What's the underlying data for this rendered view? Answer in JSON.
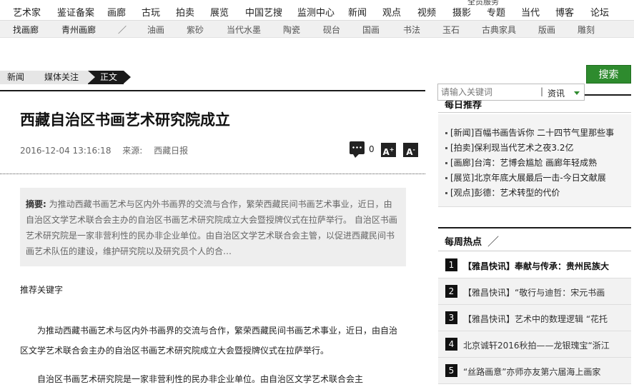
{
  "nav_top": {
    "service_tag": "全员服务",
    "items": [
      "艺术家",
      "鉴证备案",
      "画廊",
      "古玩",
      "拍卖",
      "展览",
      "中国艺搜",
      "监测中心",
      "新闻",
      "观点",
      "视频",
      "摄影",
      "专题",
      "当代",
      "博客",
      "论坛"
    ]
  },
  "nav_sub": {
    "items": [
      "找画廊",
      "青州画廊",
      "／",
      "油画",
      "紫砂",
      "当代水墨",
      "陶瓷",
      "砚台",
      "国画",
      "书法",
      "玉石",
      "古典家具",
      "版画",
      "雕刻"
    ]
  },
  "breadcrumb": [
    "新闻",
    "媒体关注",
    "正文"
  ],
  "search": {
    "placeholder": "请输入关键词",
    "separator": "|",
    "type": "资讯",
    "button": "搜索"
  },
  "article": {
    "title": "西藏自治区书画艺术研究院成立",
    "datetime": "2016-12-04 13:16:18",
    "source_label": "来源:",
    "source": "西藏日报",
    "comment_count": "0",
    "font_larger": "A",
    "font_smaller": "A",
    "summary_label": "摘要:",
    "summary": "为推动西藏书画艺术与区内外书画界的交流与合作，繁荣西藏民间书画艺术事业，近日，由自治区文学艺术联合会主办的自治区书画艺术研究院成立大会暨授牌仪式在拉萨举行。 自治区书画艺术研究院是一家非营利性的民办非企业单位。由自治区文学艺术联合会主管，以促进西藏民间书画艺术队伍的建设，维护研究院以及研究员个人的合…",
    "keywords_label": "推荐关键字",
    "paragraphs": [
      "为推动西藏书画艺术与区内外书画界的交流与合作，繁荣西藏民间书画艺术事业，近日，由自治区文学艺术联合会主办的自治区书画艺术研究院成立大会暨授牌仪式在拉萨举行。",
      "自治区书画艺术研究院是一家非营利性的民办非企业单位。由自治区文学艺术联合会主"
    ]
  },
  "daily": {
    "title": "每日推荐",
    "items": [
      "[新闻]百幅书画告诉你  二十四节气里那些事",
      "[拍卖]保利现当代艺术之夜3.2亿",
      "[画廊]台湾：艺博会尴尬  画廊年轻成熟",
      "[展览]北京年底大展最后一击-今日文献展",
      "[观点]彭德：艺术转型的代价"
    ]
  },
  "weekly": {
    "title": "每周热点",
    "slash": "／",
    "items": [
      {
        "num": "1",
        "text": "【雅昌快讯】奉献与传承：贵州民族大"
      },
      {
        "num": "2",
        "text": "【雅昌快讯】“敬行与迪哲：宋元书画"
      },
      {
        "num": "3",
        "text": "【雅昌快讯】艺术中的数理逻辑  “花托"
      },
      {
        "num": "4",
        "text": "北京诚轩2016秋拍——龙银瑰宝“浙江"
      },
      {
        "num": "5",
        "text": "“丝路画意”亦师亦友第六届海上画家"
      }
    ]
  }
}
